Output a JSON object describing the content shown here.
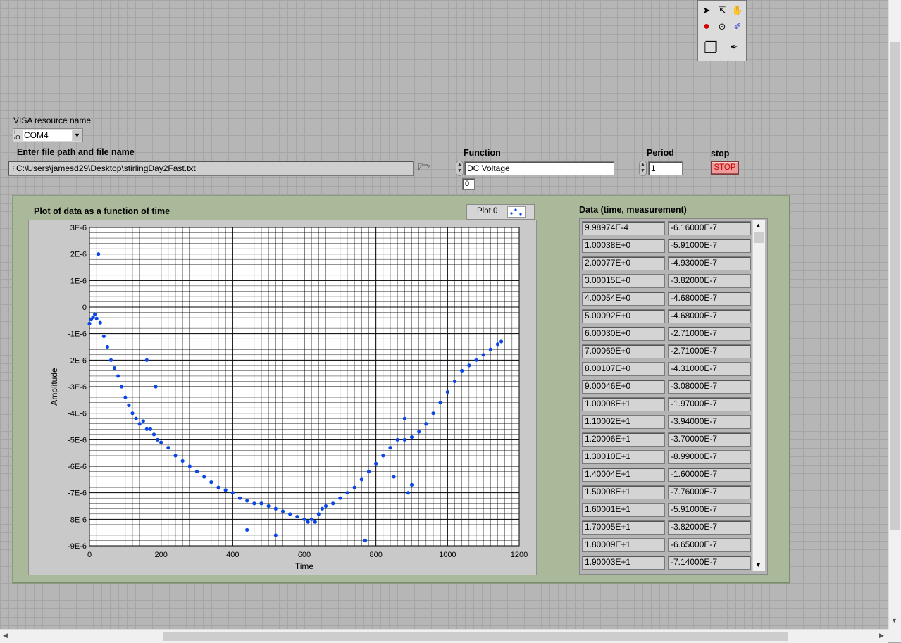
{
  "visa": {
    "label": "VISA resource name",
    "value": "COM4",
    "io_prefix": "I/O"
  },
  "filepath": {
    "label": "Enter file path and file name",
    "value": "C:\\Users\\jamesd29\\Desktop\\stirlingDay2Fast.txt"
  },
  "function": {
    "label": "Function",
    "value": "DC Voltage",
    "index": "0"
  },
  "period": {
    "label": "Period",
    "value": "1"
  },
  "stop": {
    "label": "stop",
    "button": "STOP"
  },
  "graph": {
    "title": "Plot of data as a function of time",
    "legend": "Plot 0"
  },
  "table": {
    "title": "Data (time, measurement)",
    "rows": [
      [
        "9.98974E-4",
        "-6.16000E-7"
      ],
      [
        "1.00038E+0",
        "-5.91000E-7"
      ],
      [
        "2.00077E+0",
        "-4.93000E-7"
      ],
      [
        "3.00015E+0",
        "-3.82000E-7"
      ],
      [
        "4.00054E+0",
        "-4.68000E-7"
      ],
      [
        "5.00092E+0",
        "-4.68000E-7"
      ],
      [
        "6.00030E+0",
        "-2.71000E-7"
      ],
      [
        "7.00069E+0",
        "-2.71000E-7"
      ],
      [
        "8.00107E+0",
        "-4.31000E-7"
      ],
      [
        "9.00046E+0",
        "-3.08000E-7"
      ],
      [
        "1.00008E+1",
        "-1.97000E-7"
      ],
      [
        "1.10002E+1",
        "-3.94000E-7"
      ],
      [
        "1.20006E+1",
        "-3.70000E-7"
      ],
      [
        "1.30010E+1",
        "-8.99000E-7"
      ],
      [
        "1.40004E+1",
        "-1.60000E-7"
      ],
      [
        "1.50008E+1",
        "-7.76000E-7"
      ],
      [
        "1.60001E+1",
        "-5.91000E-7"
      ],
      [
        "1.70005E+1",
        "-3.82000E-7"
      ],
      [
        "1.80009E+1",
        "-6.65000E-7"
      ],
      [
        "1.90003E+1",
        "-7.14000E-7"
      ]
    ]
  },
  "colors": {
    "plot_points": "#0a46e6",
    "cluster_bg": "#a9b99a",
    "panel_bg": "#b6b6b6",
    "stop_bg": "#ef9b9b"
  },
  "chart_data": {
    "type": "scatter",
    "title": "Plot of data as a function of time",
    "xlabel": "Time",
    "ylabel": "Amplitude",
    "xlim": [
      0,
      1200
    ],
    "ylim": [
      -9e-06,
      3e-06
    ],
    "x_ticks": [
      0,
      200,
      400,
      600,
      800,
      1000,
      1200
    ],
    "x_tick_labels": [
      "0",
      "200",
      "400",
      "600",
      "800",
      "1000",
      "1200"
    ],
    "y_ticks": [
      3e-06,
      2e-06,
      1e-06,
      0,
      -1e-06,
      -2e-06,
      -3e-06,
      -4e-06,
      -5e-06,
      -6e-06,
      -7e-06,
      -8e-06,
      -9e-06
    ],
    "y_tick_labels": [
      "3E-6",
      "2E-6",
      "1E-6",
      "0",
      "-1E-6",
      "-2E-6",
      "-3E-6",
      "-4E-6",
      "-5E-6",
      "-6E-6",
      "-7E-6",
      "-8E-6",
      "-9E-6"
    ],
    "grid": true,
    "series": [
      {
        "name": "Plot 0",
        "x": [
          0,
          5,
          10,
          15,
          20,
          30,
          40,
          50,
          60,
          70,
          80,
          90,
          100,
          110,
          120,
          130,
          140,
          150,
          160,
          170,
          180,
          190,
          200,
          220,
          240,
          260,
          280,
          300,
          320,
          340,
          360,
          380,
          400,
          420,
          440,
          460,
          480,
          500,
          520,
          540,
          560,
          580,
          600,
          610,
          620,
          630,
          640,
          650,
          660,
          680,
          700,
          720,
          740,
          760,
          780,
          800,
          820,
          840,
          860,
          880,
          900,
          920,
          940,
          960,
          980,
          1000,
          1020,
          1040,
          1060,
          1080,
          1100,
          1120,
          1140,
          1150,
          25,
          160,
          185,
          440,
          520,
          770,
          850,
          880,
          890,
          900
        ],
        "y": [
          -6.2e-07,
          -4.7e-07,
          -3.8e-07,
          -2.7e-07,
          -4.3e-07,
          -5.9e-07,
          -1.1e-06,
          -1.5e-06,
          -2e-06,
          -2.3e-06,
          -2.6e-06,
          -3e-06,
          -3.4e-06,
          -3.7e-06,
          -4e-06,
          -4.2e-06,
          -4.4e-06,
          -4.3e-06,
          -4.6e-06,
          -4.6e-06,
          -4.8e-06,
          -5e-06,
          -5.1e-06,
          -5.3e-06,
          -5.6e-06,
          -5.8e-06,
          -6e-06,
          -6.2e-06,
          -6.4e-06,
          -6.6e-06,
          -6.8e-06,
          -6.9e-06,
          -7e-06,
          -7.2e-06,
          -7.3e-06,
          -7.4e-06,
          -7.4e-06,
          -7.5e-06,
          -7.6e-06,
          -7.7e-06,
          -7.8e-06,
          -7.9e-06,
          -8e-06,
          -8.1e-06,
          -8e-06,
          -8.1e-06,
          -7.8e-06,
          -7.6e-06,
          -7.5e-06,
          -7.4e-06,
          -7.2e-06,
          -7e-06,
          -6.8e-06,
          -6.5e-06,
          -6.2e-06,
          -5.9e-06,
          -5.6e-06,
          -5.3e-06,
          -5e-06,
          -5e-06,
          -4.9e-06,
          -4.7e-06,
          -4.4e-06,
          -4e-06,
          -3.6e-06,
          -3.2e-06,
          -2.8e-06,
          -2.4e-06,
          -2.2e-06,
          -2e-06,
          -1.8e-06,
          -1.6e-06,
          -1.4e-06,
          -1.3e-06,
          2e-06,
          -2e-06,
          -3e-06,
          -8.4e-06,
          -8.6e-06,
          -8.8e-06,
          -6.4e-06,
          -4.2e-06,
          -7e-06,
          -6.7e-06
        ]
      }
    ]
  }
}
